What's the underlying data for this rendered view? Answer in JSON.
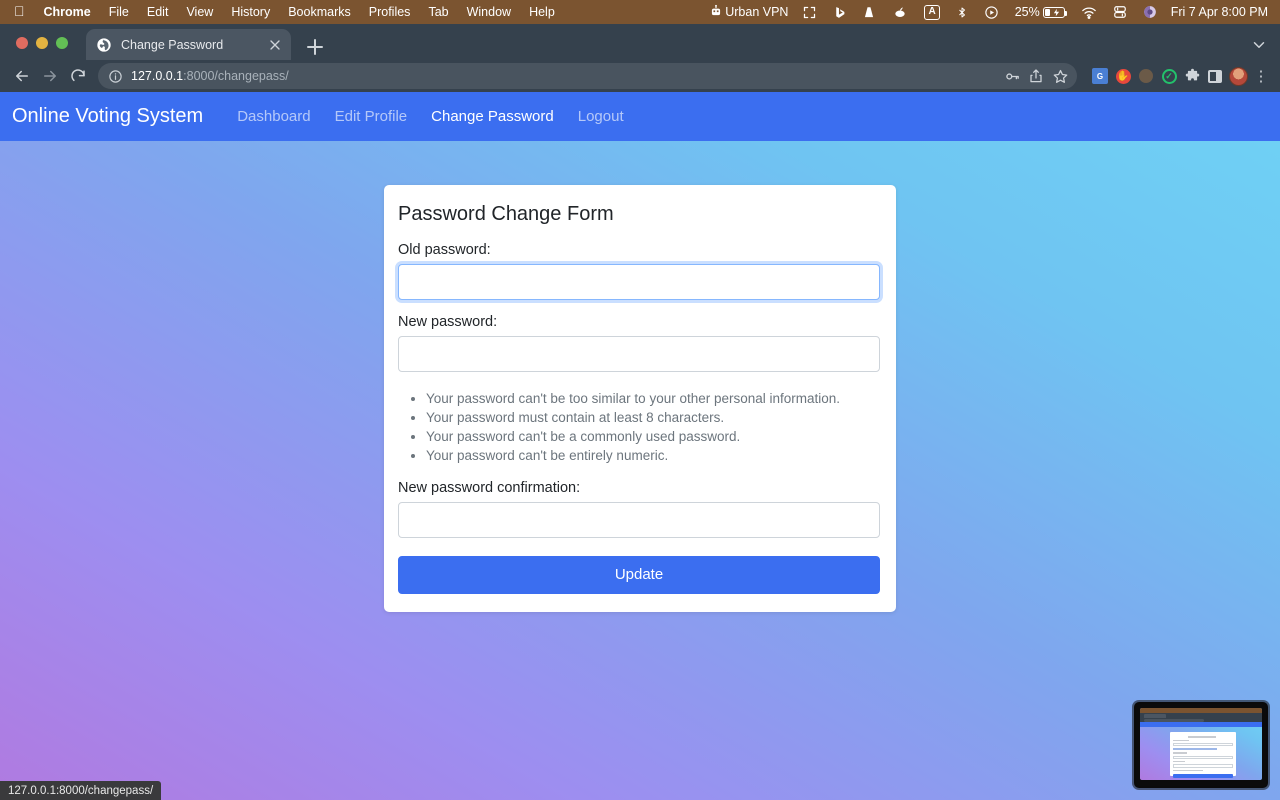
{
  "menubar": {
    "apple_icon": "apple-logo-icon",
    "items": [
      {
        "label": "Chrome",
        "bold": true
      },
      {
        "label": "File",
        "bold": false
      },
      {
        "label": "Edit",
        "bold": false
      },
      {
        "label": "View",
        "bold": false
      },
      {
        "label": "History",
        "bold": false
      },
      {
        "label": "Bookmarks",
        "bold": false
      },
      {
        "label": "Profiles",
        "bold": false
      },
      {
        "label": "Tab",
        "bold": false
      },
      {
        "label": "Window",
        "bold": false
      },
      {
        "label": "Help",
        "bold": false
      }
    ],
    "status_items": {
      "vpn_label": "Urban VPN",
      "vpn_icon": "robot-icon",
      "expand_icon": "arrows-expand-icon",
      "bing_icon": "bing-b-icon",
      "vlc_icon": "vlc-cone-icon",
      "app_icon": "app-blob-icon",
      "input_source_label": "A",
      "bluetooth_icon": "bluetooth-icon",
      "playback_icon": "play-circle-icon",
      "battery_percent": "25%",
      "battery_icon": "battery-charging-icon",
      "wifi_icon": "wifi-icon",
      "control_center_icon": "control-center-icon",
      "siri_icon": "siri-icon",
      "datetime": "Fri 7 Apr  8:00 PM"
    }
  },
  "browser": {
    "window_controls": [
      "close",
      "minimize",
      "zoom"
    ],
    "tab": {
      "favicon": "globe-favicon-icon",
      "title": "Change Password",
      "close_icon": "close-icon"
    },
    "new_tab_icon": "plus-icon",
    "tab_list_icon": "chevron-down-icon",
    "toolbar": {
      "back_icon": "arrow-back-icon",
      "forward_icon": "arrow-forward-icon",
      "reload_icon": "reload-icon",
      "site_info_icon": "info-circle-icon",
      "url_host": "127.0.0.1",
      "url_path": ":8000/changepass/",
      "url_full": "127.0.0.1:8000/changepass/",
      "password_manager_icon": "key-icon",
      "share_icon": "share-icon",
      "bookmark_icon": "star-icon",
      "extensions": [
        "google-translate-icon",
        "adblock-hand-icon",
        "honey-icon",
        "grammarly-check-icon",
        "extensions-puzzle-icon",
        "side-panel-icon"
      ],
      "profile_icon": "avatar",
      "menu_icon": "kebab-menu-icon"
    }
  },
  "page": {
    "navbar": {
      "brand": "Online Voting System",
      "links": [
        {
          "label": "Dashboard",
          "active": false
        },
        {
          "label": "Edit Profile",
          "active": false
        },
        {
          "label": "Change Password",
          "active": true
        },
        {
          "label": "Logout",
          "active": false
        }
      ]
    },
    "form": {
      "title": "Password Change Form",
      "fields": [
        {
          "label": "Old password:",
          "value": "",
          "placeholder": "",
          "focused": true,
          "name": "old-password"
        },
        {
          "label": "New password:",
          "value": "",
          "placeholder": "",
          "focused": false,
          "name": "new-password"
        },
        {
          "label": "New password confirmation:",
          "value": "",
          "placeholder": "",
          "focused": false,
          "name": "new-password-confirmation"
        }
      ],
      "help_text": [
        "Your password can't be too similar to your other personal information.",
        "Your password must contain at least 8 characters.",
        "Your password can't be a commonly used password.",
        "Your password can't be entirely numeric."
      ],
      "submit_label": "Update"
    }
  },
  "status_bubble": {
    "text": "127.0.0.1:8000/changepass/"
  },
  "pip": {
    "label": "screen-share-thumbnail"
  },
  "colors": {
    "menubar_bg": "#7b5430",
    "chrome_bg": "#35414d",
    "nav_accent": "#3b6ef0",
    "button_primary": "#3b6ef0",
    "focus_ring": "#86b7fe",
    "help_text": "#6c757d",
    "bg_gradient_start": "#b07ae0",
    "bg_gradient_end": "#6fd6f5"
  }
}
